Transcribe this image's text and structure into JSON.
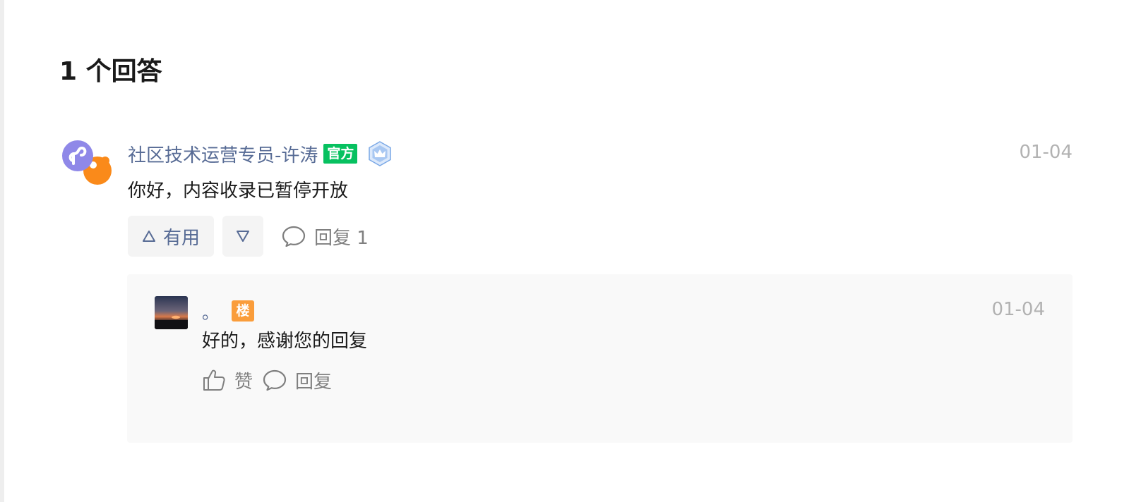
{
  "answers": {
    "title": "1 个回答"
  },
  "answer": {
    "author": "社区技术运营专员-许涛",
    "official_badge": "官方",
    "date": "01-04",
    "text": "你好，内容收录已暂停开放",
    "useful_label": "有用",
    "reply_label": "回复 1"
  },
  "reply": {
    "author": "。",
    "floor_badge": "楼",
    "date": "01-04",
    "text": "好的，感谢您的回复",
    "like_label": "赞",
    "reply_label": "回复"
  },
  "colors": {
    "link_blue": "#576b95",
    "official_green": "#07c160",
    "floor_orange": "#fa9d3b",
    "muted_gray": "#b2b2b2"
  },
  "icons": {
    "avatar": "miniprogram-logo-icon",
    "rank": "crown-hexagon-icon",
    "upvote": "triangle-up-icon",
    "downvote": "triangle-down-icon",
    "comment": "comment-bubble-icon",
    "like": "thumbs-up-icon"
  }
}
